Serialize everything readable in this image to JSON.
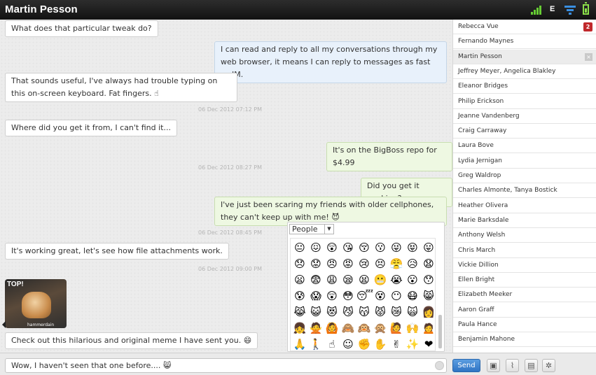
{
  "window": {
    "title": "Martin Pesson"
  },
  "status_icons": [
    "signal-icon",
    "edge-icon",
    "filter-icon",
    "battery-icon"
  ],
  "status": {
    "network": "E"
  },
  "messages": [
    {
      "side": "in",
      "text": "What does that particular tweak do?"
    },
    {
      "side": "me",
      "text": "I can read and reply to all my conversations through my web browser, it means I can reply to messages as fast as IM."
    },
    {
      "side": "in",
      "text": "That sounds useful, I've always had trouble typing on this on-screen keyboard. Fat fingers. ☝"
    },
    {
      "side": "timestamp",
      "text": "06 Dec 2012 07:12 PM"
    },
    {
      "side": "in",
      "text": "Where did you get it from, I can't find it..."
    },
    {
      "side": "out",
      "text": "It's on the BigBoss repo for $4.99"
    },
    {
      "side": "timestamp",
      "text": "06 Dec 2012 08:27 PM"
    },
    {
      "side": "out",
      "text": "Did you get it working?"
    },
    {
      "side": "out",
      "text": "I've just been scaring my friends with older cellphones, they can't keep up with me! 😈"
    },
    {
      "side": "timestamp",
      "text": "06 Dec 2012 08:45 PM"
    },
    {
      "side": "in",
      "text": "It's working great, let's see how file attachments work."
    },
    {
      "side": "timestamp",
      "text": "06 Dec 2012 09:00 PM"
    },
    {
      "side": "in-image",
      "caption": "TOP!",
      "caption2": "hammerdain"
    },
    {
      "side": "in",
      "text": "Check out this hilarious and original meme I have sent you. 😄"
    }
  ],
  "emoji_picker": {
    "category": "People",
    "emojis": [
      "😐",
      "😖",
      "😲",
      "😘",
      "😚",
      "😗",
      "😜",
      "😝",
      "😛",
      "😞",
      "😟",
      "😠",
      "😡",
      "😢",
      "😣",
      "😤",
      "😥",
      "😧",
      "😦",
      "😨",
      "😩",
      "😪",
      "😫",
      "😬",
      "😭",
      "😮",
      "😯",
      "😰",
      "😱",
      "😲",
      "😳",
      "😴",
      "😵",
      "😶",
      "😷",
      "😸",
      "😹",
      "😺",
      "😻",
      "😼",
      "😽",
      "😾",
      "😿",
      "🙀",
      "👩",
      "👧",
      "🙅",
      "🙆",
      "🙈",
      "🙉",
      "🙊",
      "🙋",
      "🙌",
      "🙍",
      "🙏",
      "🚶",
      "☝",
      "☺",
      "✊",
      "✋",
      "✌",
      "✨",
      "❤"
    ]
  },
  "contacts": [
    {
      "name": "Rebecca Vue",
      "badge": "2"
    },
    {
      "name": "Fernando Maynes"
    },
    {
      "name": "Martin Pesson",
      "active": true,
      "close": "×"
    },
    {
      "name": "Jeffrey Meyer, Angelica Blakley"
    },
    {
      "name": "Eleanor Bridges"
    },
    {
      "name": "Philip Erickson"
    },
    {
      "name": "Jeanne Vandenberg"
    },
    {
      "name": "Craig Carraway"
    },
    {
      "name": "Laura Bove"
    },
    {
      "name": "Lydia Jernigan"
    },
    {
      "name": "Greg Waldrop"
    },
    {
      "name": "Charles Almonte, Tanya Bostick"
    },
    {
      "name": "Heather Olivera"
    },
    {
      "name": "Marie Barksdale"
    },
    {
      "name": "Anthony Welsh"
    },
    {
      "name": "Chris March"
    },
    {
      "name": "Vickie Dillion"
    },
    {
      "name": "Ellen Bright"
    },
    {
      "name": "Elizabeth Meeker"
    },
    {
      "name": "Aaron Graff"
    },
    {
      "name": "Paula Hance"
    },
    {
      "name": "Benjamin Mahone"
    }
  ],
  "composer": {
    "value": "Wow, I haven't seen that one before.... 😸",
    "send_label": "Send"
  },
  "toolbar_icons": [
    "camera-icon",
    "paperclip-icon",
    "note-icon",
    "gear-icon"
  ],
  "toolbar_glyphs": {
    "camera": "▣",
    "paperclip": "⌇",
    "note": "▤",
    "gear": "✲"
  }
}
